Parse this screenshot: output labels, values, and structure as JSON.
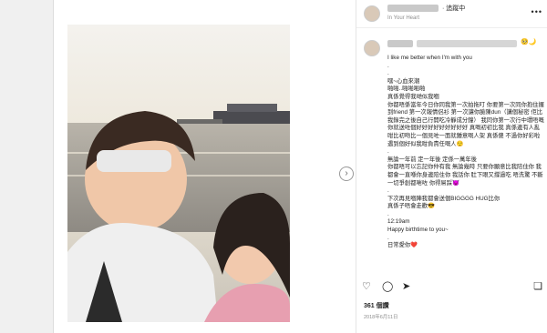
{
  "header": {
    "follow_label": "· 追蹤中",
    "subtitle": "In Your Heart"
  },
  "caption": {
    "emoji_end": "🥺🌙",
    "text": "I like me better when I'm with you\n.\n.\n嘿~心血來潮\n啪啪..啪啪啪啪\n真係覺得我哋似我嗰\n你都唔係當年今日你同我第一次拍拖叮 你要第一次同你抱住攞到friend 第一次報情侶衫 第一次讓你臉陳dun（講個秘密 佢比我錄完之後自己行開吃冷靜成分鐘） 我同你第一次行中環唔嘅你就送咗個好好好好好好好好好 真嘅初初比我 真係邊有人亂咁比初吻比一個見咗一面就鍾意嘅人架 真係傻 不過你好彩啦 遇到個好似我咁負責任嘅人😌\n.\n無論一年前 定一年後 定係一萬年後\n你都唔可以忘記你仲有我 無論幾時 只要你願意比我陪住你 我都會一直喺你身邊陪住你 我話你 肚下眼又撐過吃 唔洗驚 不斷一切爭創都啱咗 你得屌踩😈\n.\n下次再見嗰陣我都會送個BIGGGG HUG比你\n真係子唔會走歡😎\n.\n12:19am\nHappy birthtime to you~\n.\n日常愛你❤️"
  },
  "likes": "361 個讚",
  "date": "2018年6月11日",
  "photo_alt": "selfie of two people"
}
